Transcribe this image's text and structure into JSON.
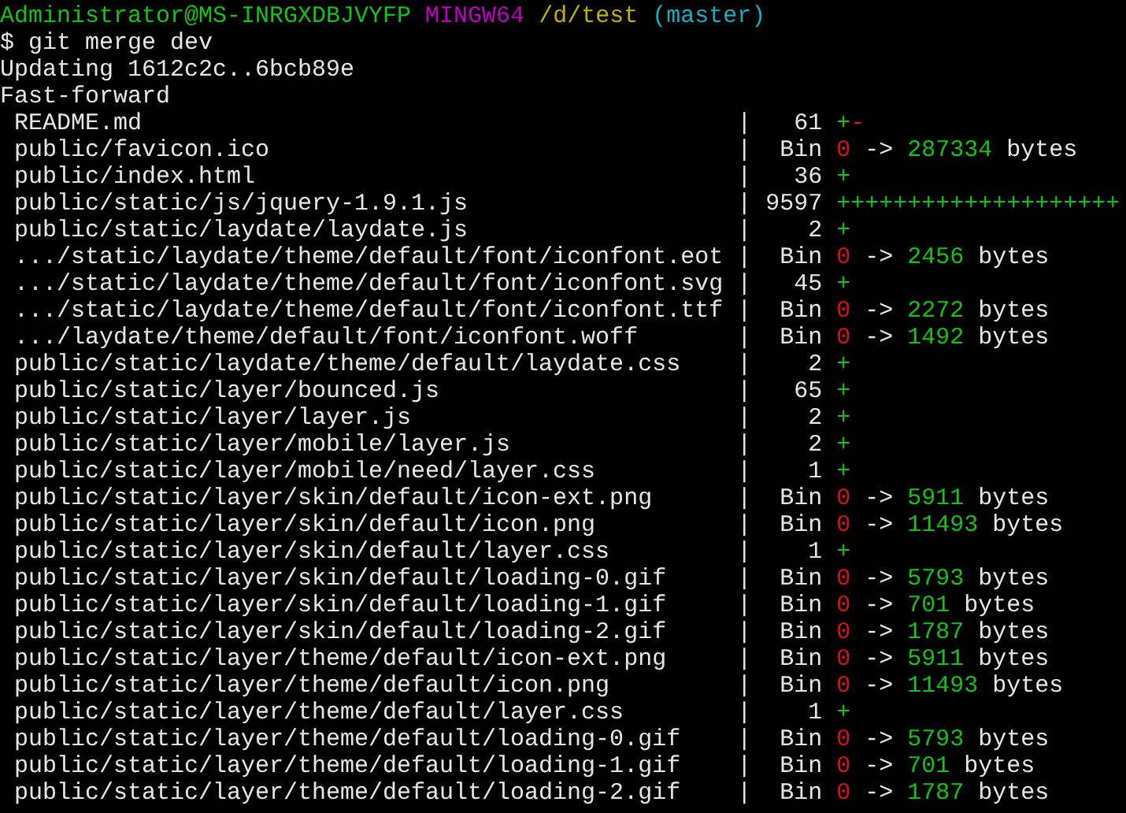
{
  "prompt": {
    "user_host": "Administrator@MS-INRGXDBJVYFP",
    "shell": "MINGW64",
    "path": "/d/test",
    "branch": "(master)"
  },
  "command": {
    "sigil": "$",
    "text": "git merge dev"
  },
  "output": [
    "Updating 1612c2c..6bcb89e",
    "Fast-forward"
  ],
  "diffstat": [
    {
      "kind": "text",
      "path": "README.md",
      "bar": "|",
      "count": "61",
      "added": "+",
      "removed": "-"
    },
    {
      "kind": "binary",
      "path": "public/favicon.ico",
      "bar": "|",
      "count": "Bin",
      "old": "0",
      "arrow": "->",
      "new": "287334",
      "unit": "bytes"
    },
    {
      "kind": "text",
      "path": "public/index.html",
      "bar": "|",
      "count": "36",
      "added": "+"
    },
    {
      "kind": "text",
      "path": "public/static/js/jquery-1.9.1.js",
      "bar": "|",
      "count": "9597",
      "added": "++++++++++++++++++++"
    },
    {
      "kind": "text",
      "path": "public/static/laydate/laydate.js",
      "bar": "|",
      "count": "2",
      "added": "+"
    },
    {
      "kind": "binary",
      "path": ".../static/laydate/theme/default/font/iconfont.eot",
      "bar": "|",
      "count": "Bin",
      "old": "0",
      "arrow": "->",
      "new": "2456",
      "unit": "bytes"
    },
    {
      "kind": "text",
      "path": ".../static/laydate/theme/default/font/iconfont.svg",
      "bar": "|",
      "count": "45",
      "added": "+"
    },
    {
      "kind": "binary",
      "path": ".../static/laydate/theme/default/font/iconfont.ttf",
      "bar": "|",
      "count": "Bin",
      "old": "0",
      "arrow": "->",
      "new": "2272",
      "unit": "bytes"
    },
    {
      "kind": "binary",
      "path": ".../laydate/theme/default/font/iconfont.woff",
      "bar": "|",
      "count": "Bin",
      "old": "0",
      "arrow": "->",
      "new": "1492",
      "unit": "bytes"
    },
    {
      "kind": "text",
      "path": "public/static/laydate/theme/default/laydate.css",
      "bar": "|",
      "count": "2",
      "added": "+"
    },
    {
      "kind": "text",
      "path": "public/static/layer/bounced.js",
      "bar": "|",
      "count": "65",
      "added": "+"
    },
    {
      "kind": "text",
      "path": "public/static/layer/layer.js",
      "bar": "|",
      "count": "2",
      "added": "+"
    },
    {
      "kind": "text",
      "path": "public/static/layer/mobile/layer.js",
      "bar": "|",
      "count": "2",
      "added": "+"
    },
    {
      "kind": "text",
      "path": "public/static/layer/mobile/need/layer.css",
      "bar": "|",
      "count": "1",
      "added": "+"
    },
    {
      "kind": "binary",
      "path": "public/static/layer/skin/default/icon-ext.png",
      "bar": "|",
      "count": "Bin",
      "old": "0",
      "arrow": "->",
      "new": "5911",
      "unit": "bytes"
    },
    {
      "kind": "binary",
      "path": "public/static/layer/skin/default/icon.png",
      "bar": "|",
      "count": "Bin",
      "old": "0",
      "arrow": "->",
      "new": "11493",
      "unit": "bytes"
    },
    {
      "kind": "text",
      "path": "public/static/layer/skin/default/layer.css",
      "bar": "|",
      "count": "1",
      "added": "+"
    },
    {
      "kind": "binary",
      "path": "public/static/layer/skin/default/loading-0.gif",
      "bar": "|",
      "count": "Bin",
      "old": "0",
      "arrow": "->",
      "new": "5793",
      "unit": "bytes"
    },
    {
      "kind": "binary",
      "path": "public/static/layer/skin/default/loading-1.gif",
      "bar": "|",
      "count": "Bin",
      "old": "0",
      "arrow": "->",
      "new": "701",
      "unit": "bytes"
    },
    {
      "kind": "binary",
      "path": "public/static/layer/skin/default/loading-2.gif",
      "bar": "|",
      "count": "Bin",
      "old": "0",
      "arrow": "->",
      "new": "1787",
      "unit": "bytes"
    },
    {
      "kind": "binary",
      "path": "public/static/layer/theme/default/icon-ext.png",
      "bar": "|",
      "count": "Bin",
      "old": "0",
      "arrow": "->",
      "new": "5911",
      "unit": "bytes"
    },
    {
      "kind": "binary",
      "path": "public/static/layer/theme/default/icon.png",
      "bar": "|",
      "count": "Bin",
      "old": "0",
      "arrow": "->",
      "new": "11493",
      "unit": "bytes"
    },
    {
      "kind": "text",
      "path": "public/static/layer/theme/default/layer.css",
      "bar": "|",
      "count": "1",
      "added": "+"
    },
    {
      "kind": "binary",
      "path": "public/static/layer/theme/default/loading-0.gif",
      "bar": "|",
      "count": "Bin",
      "old": "0",
      "arrow": "->",
      "new": "5793",
      "unit": "bytes"
    },
    {
      "kind": "binary",
      "path": "public/static/layer/theme/default/loading-1.gif",
      "bar": "|",
      "count": "Bin",
      "old": "0",
      "arrow": "->",
      "new": "701",
      "unit": "bytes"
    },
    {
      "kind": "binary",
      "path": "public/static/layer/theme/default/loading-2.gif",
      "bar": "|",
      "count": "Bin",
      "old": "0",
      "arrow": "->",
      "new": "1787",
      "unit": "bytes"
    }
  ]
}
